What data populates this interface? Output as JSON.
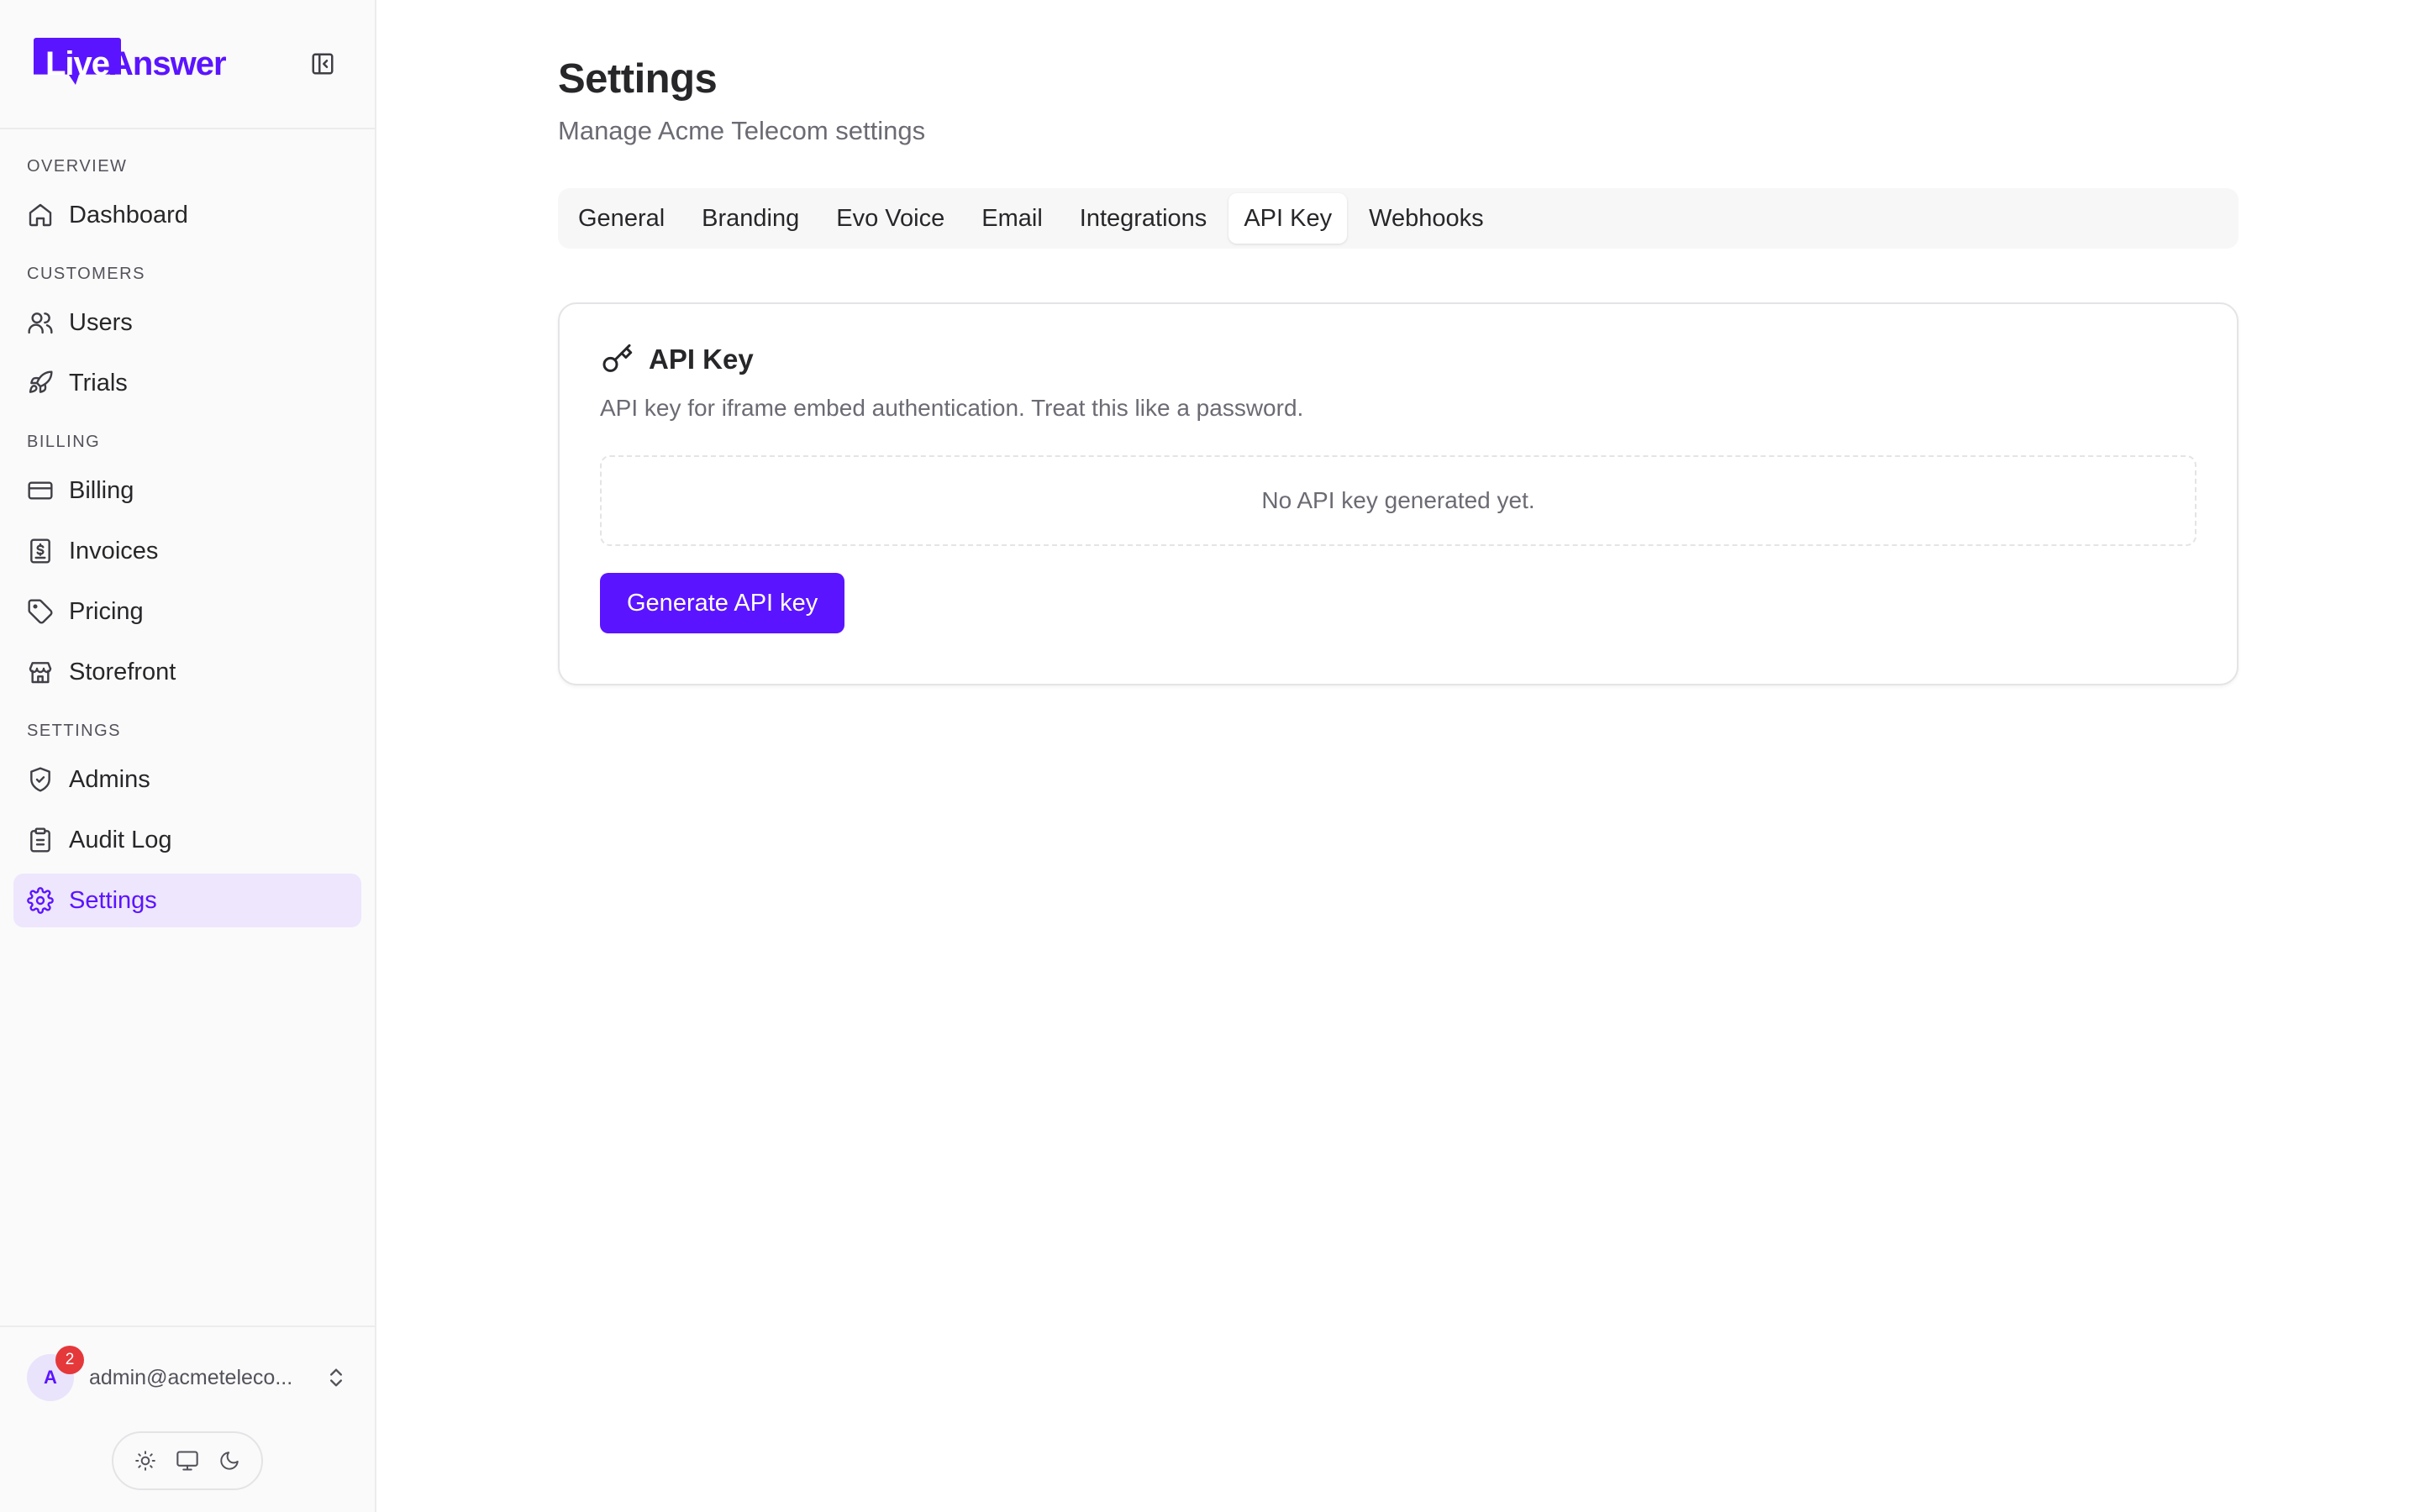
{
  "brand": {
    "name_part1": "Live",
    "name_part2": "Answer",
    "accent": "#5b14ff"
  },
  "sidebar": {
    "toggle_icon": "panel-left-icon",
    "sections": [
      {
        "label": "OVERVIEW",
        "items": [
          {
            "label": "Dashboard",
            "icon": "home-icon"
          }
        ]
      },
      {
        "label": "CUSTOMERS",
        "items": [
          {
            "label": "Users",
            "icon": "users-icon"
          },
          {
            "label": "Trials",
            "icon": "rocket-icon"
          }
        ]
      },
      {
        "label": "BILLING",
        "items": [
          {
            "label": "Billing",
            "icon": "credit-card-icon"
          },
          {
            "label": "Invoices",
            "icon": "receipt-icon"
          },
          {
            "label": "Pricing",
            "icon": "tag-icon"
          },
          {
            "label": "Storefront",
            "icon": "store-icon"
          }
        ]
      },
      {
        "label": "SETTINGS",
        "items": [
          {
            "label": "Admins",
            "icon": "shield-icon"
          },
          {
            "label": "Audit Log",
            "icon": "clipboard-icon"
          },
          {
            "label": "Settings",
            "icon": "gear-icon",
            "active": true
          }
        ]
      }
    ],
    "user": {
      "initial": "A",
      "notifications": "2",
      "email": "admin@acmeteleco..."
    },
    "theme_options": [
      "sun-icon",
      "monitor-icon",
      "moon-icon"
    ]
  },
  "main": {
    "title": "Settings",
    "subtitle": "Manage Acme Telecom settings",
    "tabs": [
      "General",
      "Branding",
      "Evo Voice",
      "Email",
      "Integrations",
      "API Key",
      "Webhooks"
    ],
    "active_tab": "API Key",
    "card": {
      "icon": "key-icon",
      "title": "API Key",
      "description": "API key for iframe embed authentication. Treat this like a password.",
      "empty_text": "No API key generated yet.",
      "button_label": "Generate API key"
    }
  }
}
